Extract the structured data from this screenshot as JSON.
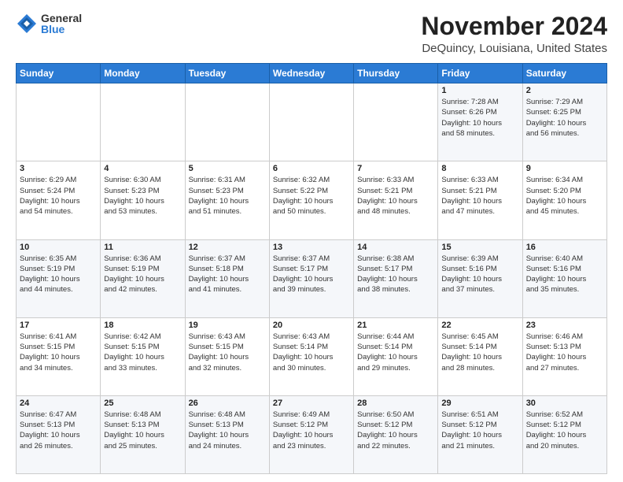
{
  "header": {
    "logo_general": "General",
    "logo_blue": "Blue",
    "month_title": "November 2024",
    "location": "DeQuincy, Louisiana, United States"
  },
  "calendar": {
    "days_of_week": [
      "Sunday",
      "Monday",
      "Tuesday",
      "Wednesday",
      "Thursday",
      "Friday",
      "Saturday"
    ],
    "weeks": [
      [
        {
          "day": "",
          "text": ""
        },
        {
          "day": "",
          "text": ""
        },
        {
          "day": "",
          "text": ""
        },
        {
          "day": "",
          "text": ""
        },
        {
          "day": "",
          "text": ""
        },
        {
          "day": "1",
          "text": "Sunrise: 7:28 AM\nSunset: 6:26 PM\nDaylight: 10 hours\nand 58 minutes."
        },
        {
          "day": "2",
          "text": "Sunrise: 7:29 AM\nSunset: 6:25 PM\nDaylight: 10 hours\nand 56 minutes."
        }
      ],
      [
        {
          "day": "3",
          "text": "Sunrise: 6:29 AM\nSunset: 5:24 PM\nDaylight: 10 hours\nand 54 minutes."
        },
        {
          "day": "4",
          "text": "Sunrise: 6:30 AM\nSunset: 5:23 PM\nDaylight: 10 hours\nand 53 minutes."
        },
        {
          "day": "5",
          "text": "Sunrise: 6:31 AM\nSunset: 5:23 PM\nDaylight: 10 hours\nand 51 minutes."
        },
        {
          "day": "6",
          "text": "Sunrise: 6:32 AM\nSunset: 5:22 PM\nDaylight: 10 hours\nand 50 minutes."
        },
        {
          "day": "7",
          "text": "Sunrise: 6:33 AM\nSunset: 5:21 PM\nDaylight: 10 hours\nand 48 minutes."
        },
        {
          "day": "8",
          "text": "Sunrise: 6:33 AM\nSunset: 5:21 PM\nDaylight: 10 hours\nand 47 minutes."
        },
        {
          "day": "9",
          "text": "Sunrise: 6:34 AM\nSunset: 5:20 PM\nDaylight: 10 hours\nand 45 minutes."
        }
      ],
      [
        {
          "day": "10",
          "text": "Sunrise: 6:35 AM\nSunset: 5:19 PM\nDaylight: 10 hours\nand 44 minutes."
        },
        {
          "day": "11",
          "text": "Sunrise: 6:36 AM\nSunset: 5:19 PM\nDaylight: 10 hours\nand 42 minutes."
        },
        {
          "day": "12",
          "text": "Sunrise: 6:37 AM\nSunset: 5:18 PM\nDaylight: 10 hours\nand 41 minutes."
        },
        {
          "day": "13",
          "text": "Sunrise: 6:37 AM\nSunset: 5:17 PM\nDaylight: 10 hours\nand 39 minutes."
        },
        {
          "day": "14",
          "text": "Sunrise: 6:38 AM\nSunset: 5:17 PM\nDaylight: 10 hours\nand 38 minutes."
        },
        {
          "day": "15",
          "text": "Sunrise: 6:39 AM\nSunset: 5:16 PM\nDaylight: 10 hours\nand 37 minutes."
        },
        {
          "day": "16",
          "text": "Sunrise: 6:40 AM\nSunset: 5:16 PM\nDaylight: 10 hours\nand 35 minutes."
        }
      ],
      [
        {
          "day": "17",
          "text": "Sunrise: 6:41 AM\nSunset: 5:15 PM\nDaylight: 10 hours\nand 34 minutes."
        },
        {
          "day": "18",
          "text": "Sunrise: 6:42 AM\nSunset: 5:15 PM\nDaylight: 10 hours\nand 33 minutes."
        },
        {
          "day": "19",
          "text": "Sunrise: 6:43 AM\nSunset: 5:15 PM\nDaylight: 10 hours\nand 32 minutes."
        },
        {
          "day": "20",
          "text": "Sunrise: 6:43 AM\nSunset: 5:14 PM\nDaylight: 10 hours\nand 30 minutes."
        },
        {
          "day": "21",
          "text": "Sunrise: 6:44 AM\nSunset: 5:14 PM\nDaylight: 10 hours\nand 29 minutes."
        },
        {
          "day": "22",
          "text": "Sunrise: 6:45 AM\nSunset: 5:14 PM\nDaylight: 10 hours\nand 28 minutes."
        },
        {
          "day": "23",
          "text": "Sunrise: 6:46 AM\nSunset: 5:13 PM\nDaylight: 10 hours\nand 27 minutes."
        }
      ],
      [
        {
          "day": "24",
          "text": "Sunrise: 6:47 AM\nSunset: 5:13 PM\nDaylight: 10 hours\nand 26 minutes."
        },
        {
          "day": "25",
          "text": "Sunrise: 6:48 AM\nSunset: 5:13 PM\nDaylight: 10 hours\nand 25 minutes."
        },
        {
          "day": "26",
          "text": "Sunrise: 6:48 AM\nSunset: 5:13 PM\nDaylight: 10 hours\nand 24 minutes."
        },
        {
          "day": "27",
          "text": "Sunrise: 6:49 AM\nSunset: 5:12 PM\nDaylight: 10 hours\nand 23 minutes."
        },
        {
          "day": "28",
          "text": "Sunrise: 6:50 AM\nSunset: 5:12 PM\nDaylight: 10 hours\nand 22 minutes."
        },
        {
          "day": "29",
          "text": "Sunrise: 6:51 AM\nSunset: 5:12 PM\nDaylight: 10 hours\nand 21 minutes."
        },
        {
          "day": "30",
          "text": "Sunrise: 6:52 AM\nSunset: 5:12 PM\nDaylight: 10 hours\nand 20 minutes."
        }
      ]
    ]
  }
}
